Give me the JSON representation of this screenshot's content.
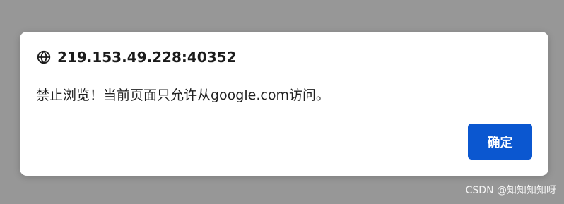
{
  "dialog": {
    "title": "219.153.49.228:40352",
    "title_icon": "globe-icon",
    "message": "禁止浏览！当前页面只允许从google.com访问。",
    "ok_label": "确定"
  },
  "watermark": {
    "text": "CSDN @知知知知呀"
  },
  "colors": {
    "overlay": "#979797",
    "dialog_bg": "#ffffff",
    "button_bg": "#0b57d0",
    "button_text": "#ffffff",
    "title_text": "#1b1b1b"
  }
}
